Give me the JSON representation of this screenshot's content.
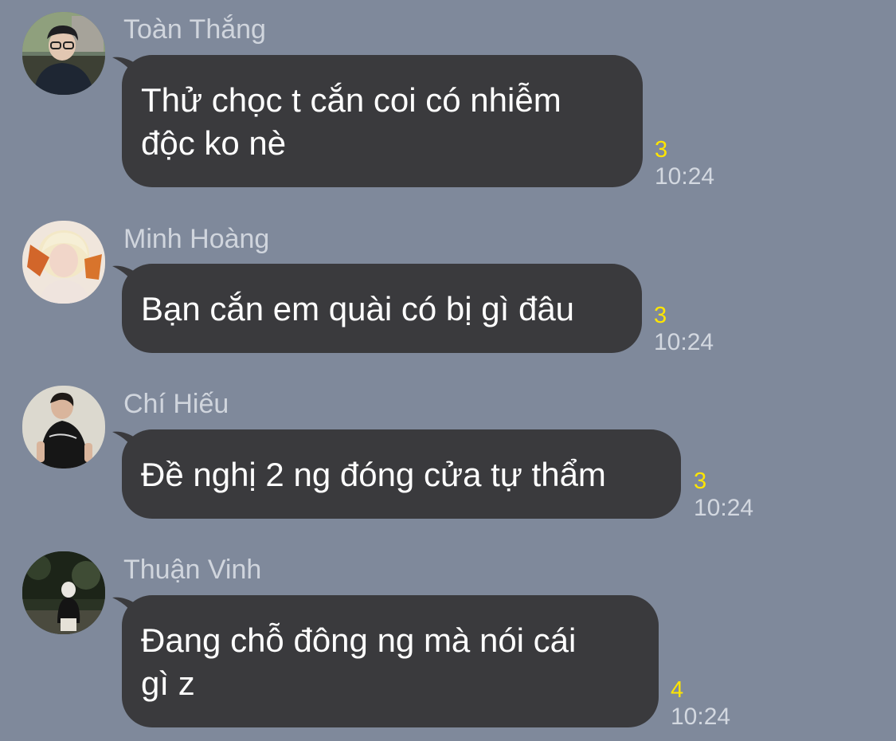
{
  "messages": [
    {
      "sender": "Toàn Thắng",
      "text": "Thử chọc t cắn coi có nhiễm\nđộc ko nè",
      "read_count": "3",
      "time": "10:24",
      "avatar": "avatar-toan-thang"
    },
    {
      "sender": "Minh Hoàng",
      "text": "Bạn cắn em quài có bị gì đâu",
      "read_count": "3",
      "time": "10:24",
      "avatar": "avatar-minh-hoang"
    },
    {
      "sender": "Chí Hiếu",
      "text": "Đề nghị 2 ng đóng cửa tự thẩm",
      "read_count": "3",
      "time": "10:24",
      "avatar": "avatar-chi-hieu"
    },
    {
      "sender": "Thuận Vinh",
      "text": "Đang chỗ đông ng mà nói cái\ngì z",
      "read_count": "4",
      "time": "10:24",
      "avatar": "avatar-thuan-vinh"
    }
  ],
  "colors": {
    "background": "#7f899b",
    "bubble": "#3a3a3d",
    "read_count": "#ffe500",
    "time": "#d3d8e0",
    "sender": "#d0d5dd"
  }
}
